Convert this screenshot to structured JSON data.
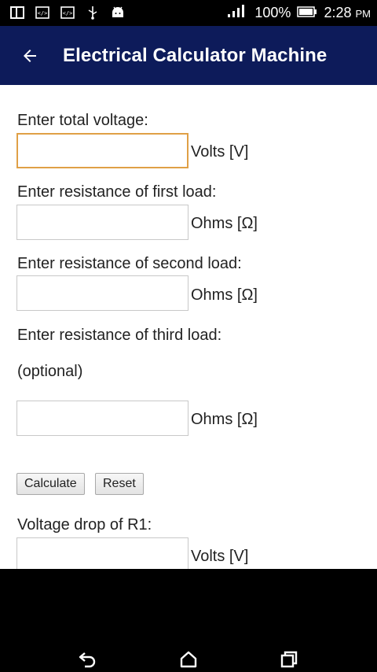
{
  "status_bar": {
    "battery": "100%",
    "time": "2:28",
    "ampm": "PM",
    "left_icons": [
      "window-icon",
      "code-icon",
      "code-icon",
      "usb-icon",
      "android-icon"
    ]
  },
  "app_bar": {
    "title": "Electrical Calculator Machine",
    "back_icon": "arrow-left-icon",
    "color": "#0d1b5a"
  },
  "form": {
    "voltage_label": "Enter total voltage:",
    "voltage_value": "",
    "voltage_unit": "Volts [V]",
    "r1_label": "Enter resistance of first load:",
    "r1_value": "",
    "r1_unit": "Ohms [Ω]",
    "r2_label": "Enter resistance of second load:",
    "r2_value": "",
    "r2_unit": "Ohms [Ω]",
    "r3_label": "Enter resistance of third load:",
    "r3_optional": "(optional)",
    "r3_value": "",
    "r3_unit": "Ohms [Ω]"
  },
  "buttons": {
    "calculate": "Calculate",
    "reset": "Reset"
  },
  "results": {
    "vdrop_r1_label": "Voltage drop of R1:",
    "vdrop_r1_value": "",
    "vdrop_r1_unit": "Volts [V]"
  },
  "nav": {
    "back_icon": "back-icon",
    "home_icon": "home-icon",
    "recents_icon": "recents-icon"
  },
  "colors": {
    "focus_border": "#e0a046"
  }
}
